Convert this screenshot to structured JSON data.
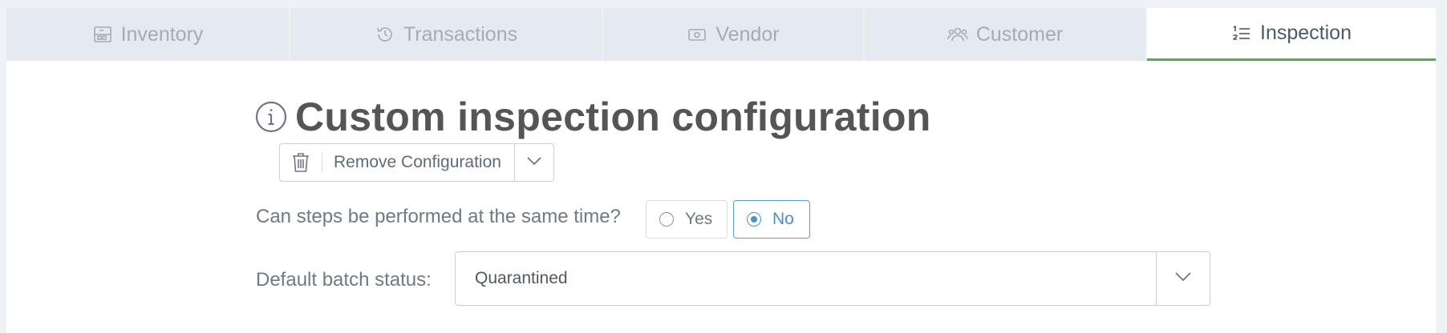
{
  "tabs": [
    {
      "label": "Inventory",
      "icon": "warehouse-icon",
      "active": false
    },
    {
      "label": "Transactions",
      "icon": "history-icon",
      "active": false
    },
    {
      "label": "Vendor",
      "icon": "money-icon",
      "active": false
    },
    {
      "label": "Customer",
      "icon": "users-icon",
      "active": false
    },
    {
      "label": "Inspection",
      "icon": "ordered-list-icon",
      "active": true
    }
  ],
  "header": {
    "title": "Custom inspection configuration",
    "info_icon": "info-icon"
  },
  "actions": {
    "remove_label": "Remove Configuration",
    "remove_icon": "trash-icon",
    "dropdown_icon": "chevron-down-icon"
  },
  "concurrency": {
    "question": "Can steps be performed at the same time?",
    "options": [
      {
        "label": "Yes",
        "selected": false
      },
      {
        "label": "No",
        "selected": true
      }
    ]
  },
  "batch_status": {
    "label": "Default batch status:",
    "value": "Quarantined"
  },
  "colors": {
    "active_tab_indicator": "#4caf50",
    "selected_option": "#4a8fd0",
    "title": "#555555"
  }
}
